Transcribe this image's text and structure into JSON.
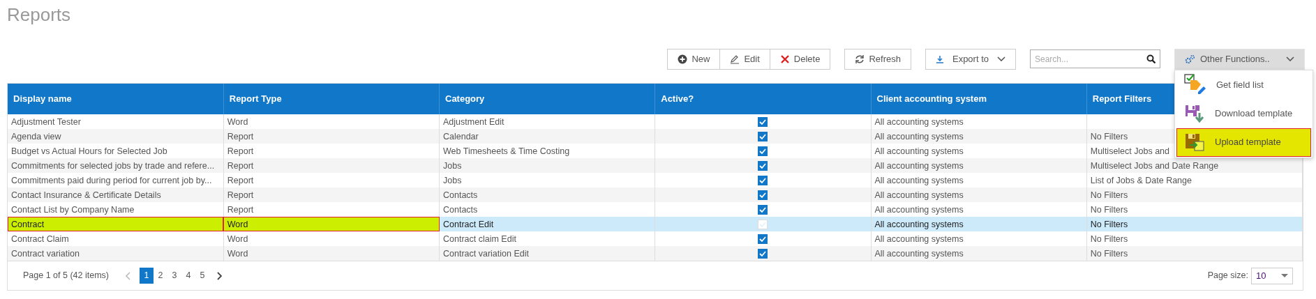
{
  "page": {
    "title": "Reports"
  },
  "toolbar": {
    "buttons": [
      {
        "label": "New",
        "kind": "new"
      },
      {
        "label": "Edit",
        "kind": "edit"
      },
      {
        "label": "Delete",
        "kind": "delete"
      }
    ],
    "refresh": {
      "label": "Refresh"
    },
    "export": {
      "label": "Export to"
    },
    "search": {
      "placeholder": "Search..."
    },
    "other_functions": {
      "label": "Other Functions..",
      "expanded": true,
      "items": [
        {
          "label": "Get field list",
          "kind": "field-list",
          "selected": false
        },
        {
          "label": "Download template",
          "kind": "download",
          "selected": false
        },
        {
          "label": "Upload template",
          "kind": "upload",
          "selected": true
        }
      ]
    }
  },
  "table": {
    "columns": [
      "Display name",
      "Report Type",
      "Category",
      "Active?",
      "Client accounting system",
      "Report Filters"
    ],
    "rows": [
      {
        "display_name": "Adjustment Tester",
        "report_type": "Word",
        "category": "Adjustment Edit",
        "active": true,
        "accounting_system": "All accounting systems",
        "selected": false,
        "highlighted": false
      },
      {
        "display_name": "Agenda view",
        "report_type": "Report",
        "category": "Calendar",
        "active": true,
        "accounting_system": "All accounting systems",
        "report_filters": "No Filters",
        "selected": false,
        "highlighted": false
      },
      {
        "display_name": "Budget vs Actual Hours for Selected Job",
        "report_type": "Report",
        "category": "Web Timesheets & Time Costing",
        "active": true,
        "accounting_system": "All accounting systems",
        "report_filters": "Multiselect Jobs and",
        "selected": false,
        "highlighted": false
      },
      {
        "display_name": "Commitments for selected jobs by trade and refere...",
        "report_type": "Report",
        "category": "Jobs",
        "active": true,
        "accounting_system": "All accounting systems",
        "report_filters": "Multiselect Jobs and Date Range",
        "selected": false,
        "highlighted": false
      },
      {
        "display_name": "Commitments paid during period for current job by...",
        "report_type": "Report",
        "category": "Jobs",
        "active": true,
        "accounting_system": "All accounting systems",
        "report_filters": "List of Jobs & Date Range",
        "selected": false,
        "highlighted": false
      },
      {
        "display_name": "Contact Insurance & Certificate Details",
        "report_type": "Report",
        "category": "Contacts",
        "active": true,
        "accounting_system": "All accounting systems",
        "report_filters": "No Filters",
        "selected": false,
        "highlighted": false
      },
      {
        "display_name": "Contact List by Company Name",
        "report_type": "Report",
        "category": "Contacts",
        "active": true,
        "accounting_system": "All accounting systems",
        "report_filters": "No Filters",
        "selected": false,
        "highlighted": false
      },
      {
        "display_name": "Contract",
        "report_type": "Word",
        "category": "Contract Edit",
        "active": true,
        "accounting_system": "All accounting systems",
        "report_filters": "No Filters",
        "selected": true,
        "highlighted": true
      },
      {
        "display_name": "Contract Claim",
        "report_type": "Word",
        "category": "Contract claim Edit",
        "active": true,
        "accounting_system": "All accounting systems",
        "report_filters": "No Filters",
        "selected": false,
        "highlighted": false
      },
      {
        "display_name": "Contract variation",
        "report_type": "Word",
        "category": "Contract variation Edit",
        "active": true,
        "accounting_system": "All accounting systems",
        "report_filters": "No Filters",
        "selected": false,
        "highlighted": false
      }
    ]
  },
  "pager": {
    "summary": "Page 1 of 5 (42 items)",
    "pages": [
      {
        "label": "1",
        "selected": true
      },
      {
        "label": "2",
        "selected": false
      },
      {
        "label": "3",
        "selected": false
      },
      {
        "label": "4",
        "selected": false
      },
      {
        "label": "5",
        "selected": false
      }
    ],
    "page_size_label": "Page size:",
    "page_size": "10"
  }
}
